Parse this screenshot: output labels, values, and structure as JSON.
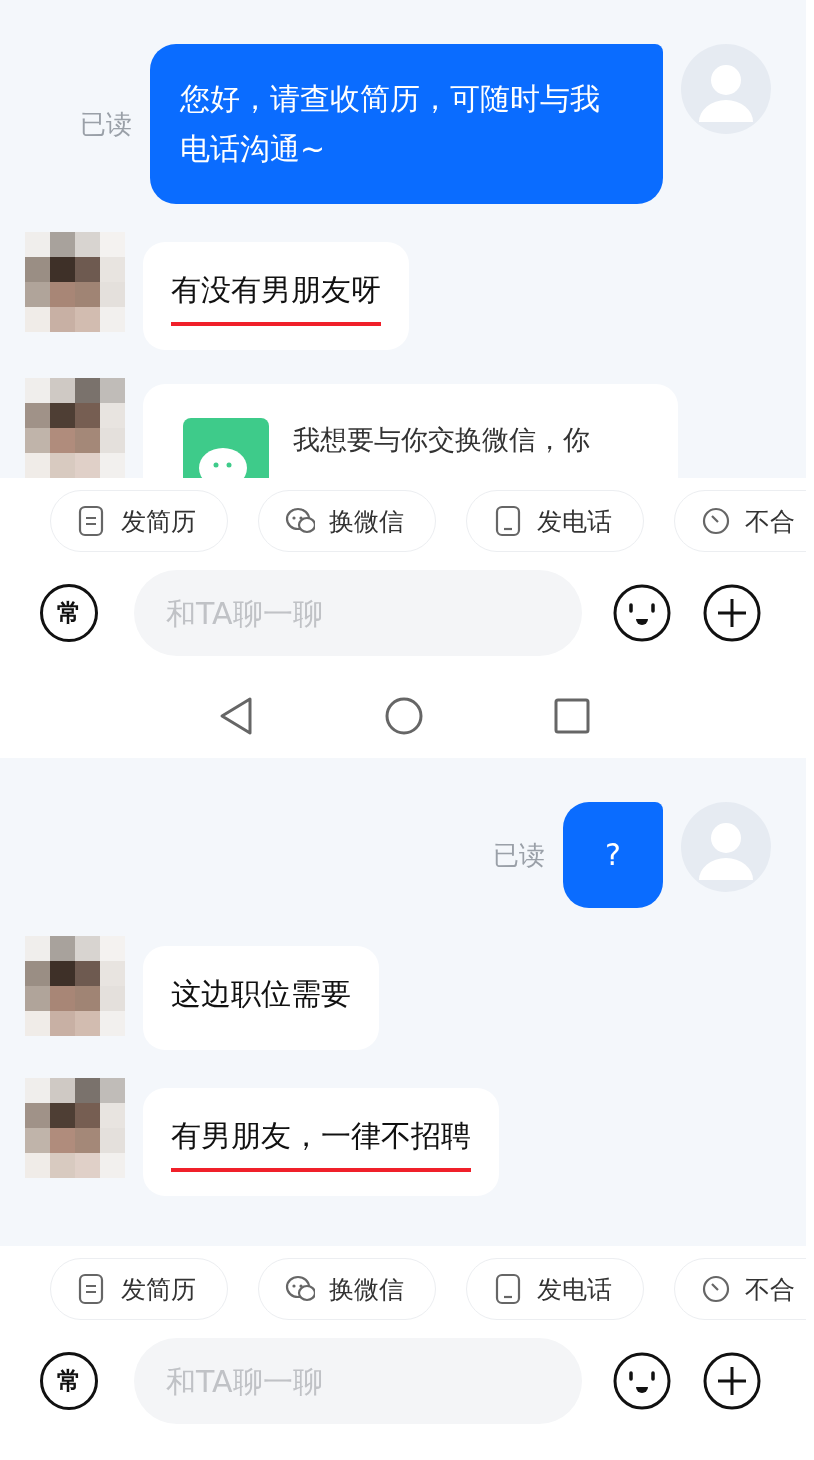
{
  "screenshots": [
    {
      "messages": [
        {
          "kind": "sent",
          "text": "您好，请查收简历，可随时与我电话沟通~",
          "read_label": "已读"
        },
        {
          "kind": "received",
          "text": "有没有男朋友呀",
          "underlined": true
        },
        {
          "kind": "card",
          "text": "我想要与你交换微信，你"
        }
      ],
      "quick_actions": [
        {
          "kind": "resume",
          "label": "发简历"
        },
        {
          "kind": "wechat",
          "label": "换微信"
        },
        {
          "kind": "phone",
          "label": "发电话"
        },
        {
          "kind": "reject",
          "label": "不合"
        }
      ],
      "input": {
        "badge": "常",
        "placeholder": "和TA聊一聊"
      },
      "nav_bar": true
    },
    {
      "messages": [
        {
          "kind": "sent",
          "text": "?",
          "read_label": "已读"
        },
        {
          "kind": "received",
          "text": "这边职位需要",
          "underlined": false
        },
        {
          "kind": "received",
          "text": "有男朋友，一律不招聘",
          "underlined": true
        }
      ],
      "quick_actions": [
        {
          "kind": "resume",
          "label": "发简历"
        },
        {
          "kind": "wechat",
          "label": "换微信"
        },
        {
          "kind": "phone",
          "label": "发电话"
        },
        {
          "kind": "reject",
          "label": "不合"
        }
      ],
      "input": {
        "badge": "常",
        "placeholder": "和TA聊一聊"
      },
      "nav_bar": false
    }
  ]
}
